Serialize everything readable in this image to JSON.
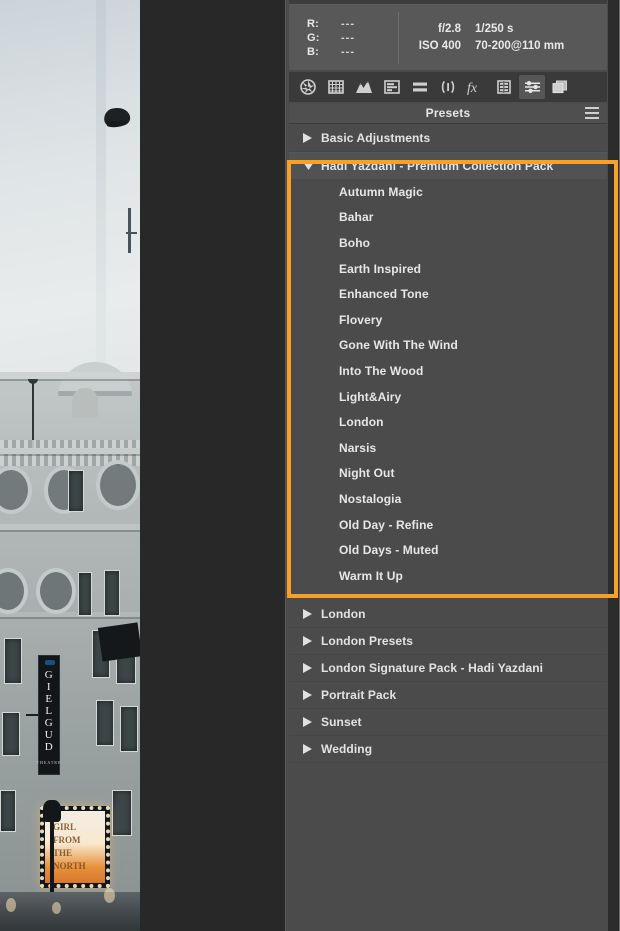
{
  "app": {
    "panel_title": "Presets"
  },
  "info": {
    "rgb": [
      {
        "label": "R:",
        "value": "---"
      },
      {
        "label": "G:",
        "value": "---"
      },
      {
        "label": "B:",
        "value": "---"
      }
    ],
    "exif": [
      {
        "left": "f/2.8",
        "right": "1/250 s"
      },
      {
        "left": "ISO 400",
        "right": "70-200@110 mm"
      }
    ]
  },
  "toolbar": {
    "icons": [
      {
        "name": "aperture-icon",
        "active": false
      },
      {
        "name": "grid-icon",
        "active": false
      },
      {
        "name": "mountains-icon",
        "active": false
      },
      {
        "name": "levels-icon",
        "active": false
      },
      {
        "name": "sliders-bars-icon",
        "active": false
      },
      {
        "name": "brackets-icon",
        "active": false
      },
      {
        "name": "fx-icon",
        "active": false
      },
      {
        "name": "layers-list-icon",
        "active": false
      },
      {
        "name": "adjustments-icon",
        "active": true
      },
      {
        "name": "copy-layers-icon",
        "active": false
      }
    ],
    "menu_icon": "hamburger-menu-icon"
  },
  "presets": {
    "groups": [
      {
        "label": "Basic Adjustments",
        "expanded": false,
        "selected": false,
        "items": []
      },
      {
        "label": "Hadi Yazdani - Premium Collection Pack",
        "expanded": true,
        "selected": true,
        "items": [
          "Autumn Magic",
          "Bahar",
          "Boho",
          "Earth Inspired",
          "Enhanced Tone",
          "Flovery",
          "Gone With The Wind",
          "Into The Wood",
          "Light&Airy",
          "London",
          "Narsis",
          "Night Out",
          "Nostalogia",
          "Old Day - Refine",
          "Old Days - Muted",
          "Warm It Up"
        ]
      },
      {
        "label": "London",
        "expanded": false,
        "selected": false,
        "items": []
      },
      {
        "label": "London Presets",
        "expanded": false,
        "selected": false,
        "items": []
      },
      {
        "label": "London Signature Pack - Hadi Yazdani",
        "expanded": false,
        "selected": false,
        "items": []
      },
      {
        "label": "Portrait Pack",
        "expanded": false,
        "selected": false,
        "items": []
      },
      {
        "label": "Sunset",
        "expanded": false,
        "selected": false,
        "items": []
      },
      {
        "label": "Wedding",
        "expanded": false,
        "selected": false,
        "items": []
      }
    ]
  },
  "photo": {
    "theatre_sign": "GIELGUD",
    "theatre_sign_sub": "THEATRE",
    "marquee_text": "GIRL FROM THE NORTH"
  },
  "colors": {
    "highlight": "#f6a228",
    "panel_bg": "#4b4b4b",
    "toolbar_bg": "#3a3a3a",
    "info_bg": "#585858",
    "text": "#e7e7e7"
  }
}
